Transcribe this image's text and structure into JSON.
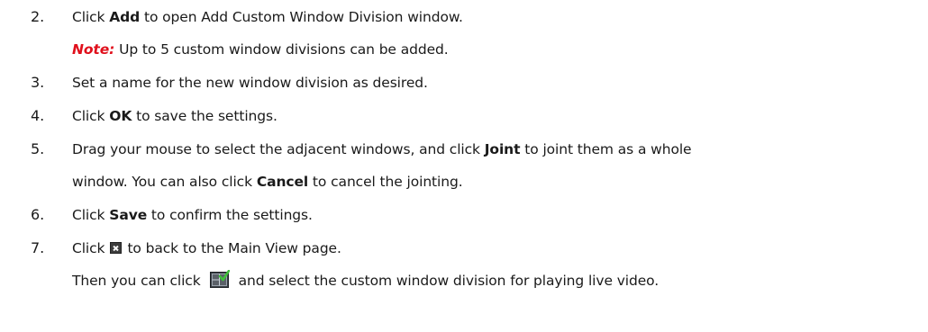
{
  "steps": [
    {
      "num": "2.",
      "pre": "Click ",
      "bold": "Add",
      "post": " to open Add Custom Window Division window."
    },
    {
      "note_label": "Note:",
      "note_text": " Up to 5 custom window divisions can be added."
    },
    {
      "num": "3.",
      "text": "Set a name for the new window division as desired."
    },
    {
      "num": "4.",
      "pre": "Click ",
      "bold": "OK",
      "post": " to save the settings."
    },
    {
      "num": "5.",
      "pre": "Drag your mouse to select the adjacent windows, and click ",
      "bold": "Joint",
      "post": " to joint them as a whole"
    },
    {
      "pre": "window. You can also click ",
      "bold": "Cancel",
      "post": " to cancel the jointing."
    },
    {
      "num": "6.",
      "pre": "Click ",
      "bold": "Save",
      "post": " to confirm the settings."
    },
    {
      "num": "7.",
      "pre": "Click",
      "post": "to back to the Main View page.",
      "icon": "close-icon"
    },
    {
      "pre": "Then you can click",
      "post": "and select the custom window division for playing live video.",
      "icon": "window-division-icon"
    }
  ],
  "colors": {
    "note": "#e0101c",
    "text": "#1a1a1a"
  }
}
